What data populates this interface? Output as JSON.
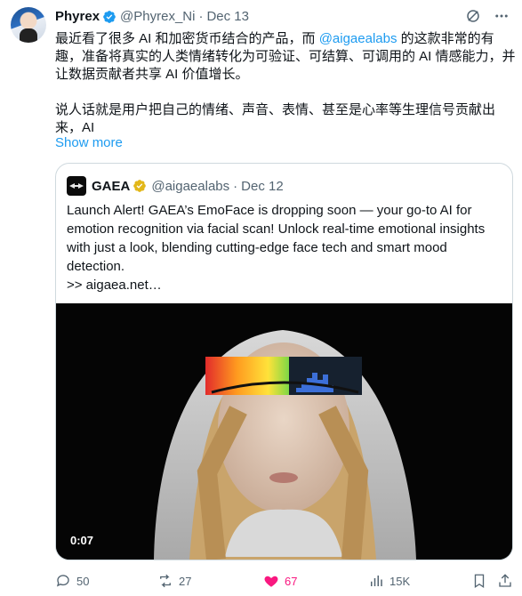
{
  "tweet": {
    "author_name": "Phyrex",
    "handle": "@Phyrex_Ni",
    "separator": "·",
    "date": "Dec 13",
    "text_part1": "最近看了很多 AI 和加密货币结合的产品，而 ",
    "mention": "@aigaealabs",
    "text_part2": " 的这款非常的有趣，准备将真实的人类情绪转化为可验证、可结算、可调用的 AI 情感能力，并让数据贡献者共享 AI 价值增长。",
    "text_para2": "说人话就是用户把自己的情绪、声音、表情、甚至是心率等生理信号贡献出来，AI",
    "show_more": "Show more"
  },
  "quote": {
    "author_name": "GAEA",
    "handle": "@aigaealabs",
    "separator": "·",
    "date": "Dec 12",
    "text": "Launch Alert! GAEA’s EmoFace is dropping soon — your go-to AI for emotion recognition via facial scan! Unlock real-time emotional insights with just a look, blending cutting-edge face tech and smart mood detection.",
    "link": ">> aigaea.net…",
    "video_duration": "0:07"
  },
  "actions": {
    "replies": "50",
    "reposts": "27",
    "likes": "67",
    "views": "15K"
  },
  "colors": {
    "accent": "#1d9bf0",
    "like": "#f91880",
    "muted": "#536471",
    "verified_gold": "#e2b719"
  }
}
